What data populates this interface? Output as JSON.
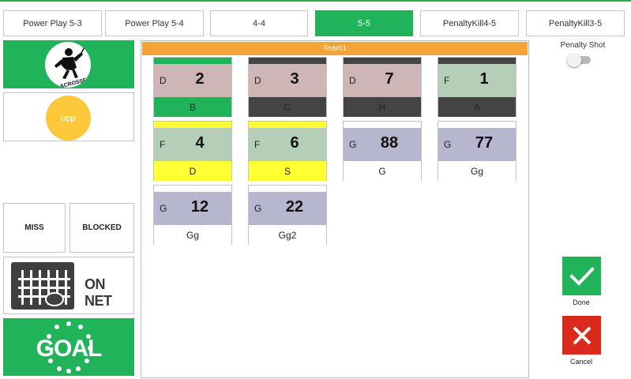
{
  "tabs": [
    {
      "label": "Power Play 5-3",
      "active": false
    },
    {
      "label": "Power Play 5-4",
      "active": false
    },
    {
      "label": "4-4",
      "active": false
    },
    {
      "label": "5-5",
      "active": true
    },
    {
      "label": "PenaltyKill4-5",
      "active": false
    },
    {
      "label": "PenaltyKill3-5",
      "active": false
    }
  ],
  "team_bar": "Team1",
  "opp_label": "opp",
  "shot_buttons": {
    "miss": "MISS",
    "blocked": "BLOCKED",
    "on_net": "ON NET"
  },
  "logo_text": "LACROSSE",
  "goal_text": "GOAL",
  "penalty_shot": {
    "label": "Penalty Shot",
    "on": false
  },
  "actions": {
    "done": "Done",
    "cancel": "Cancel"
  },
  "players": [
    {
      "pos": "D",
      "num": "2",
      "name": "B",
      "strip": "#21b35a",
      "mid": "#ceb6b6",
      "foot": "#21b35a",
      "foot_text": "#222222"
    },
    {
      "pos": "D",
      "num": "3",
      "name": "C",
      "strip": "#444444",
      "mid": "#ceb6b6",
      "foot": "#444444",
      "foot_text": "#222222"
    },
    {
      "pos": "D",
      "num": "7",
      "name": "H",
      "strip": "#444444",
      "mid": "#ceb6b6",
      "foot": "#444444",
      "foot_text": "#222222"
    },
    {
      "pos": "F",
      "num": "1",
      "name": "A",
      "strip": "#444444",
      "mid": "#b5ceb8",
      "foot": "#444444",
      "foot_text": "#222222"
    },
    {
      "pos": "F",
      "num": "4",
      "name": "D",
      "strip": "#ffff33",
      "mid": "#b5ceb8",
      "foot": "#ffff33",
      "foot_text": "#222222"
    },
    {
      "pos": "F",
      "num": "6",
      "name": "S",
      "strip": "#ffff33",
      "mid": "#b5ceb8",
      "foot": "#ffff33",
      "foot_text": "#222222"
    },
    {
      "pos": "G",
      "num": "88",
      "name": "G",
      "strip": "#ffffff",
      "mid": "#b6b6ce",
      "foot": "#ffffff",
      "foot_text": "#222222"
    },
    {
      "pos": "G",
      "num": "77",
      "name": "Gg",
      "strip": "#ffffff",
      "mid": "#b6b6ce",
      "foot": "#ffffff",
      "foot_text": "#222222"
    },
    {
      "pos": "G",
      "num": "12",
      "name": "Gg",
      "strip": "#ffffff",
      "mid": "#b6b6ce",
      "foot": "#ffffff",
      "foot_text": "#222222"
    },
    {
      "pos": "G",
      "num": "22",
      "name": "Gg2",
      "strip": "#ffffff",
      "mid": "#b6b6ce",
      "foot": "#ffffff",
      "foot_text": "#222222"
    }
  ]
}
